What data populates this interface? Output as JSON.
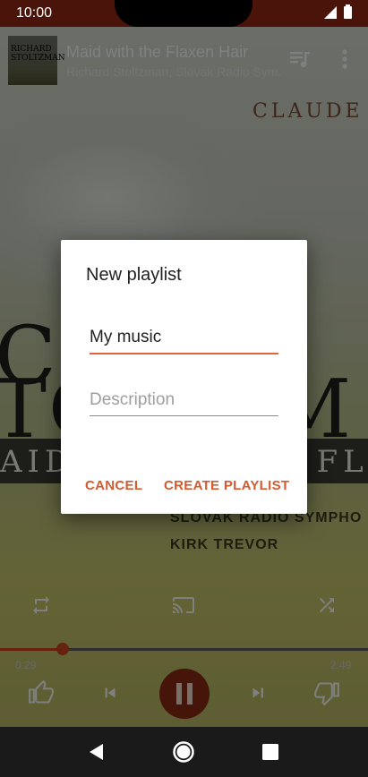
{
  "status_bar": {
    "time": "10:00"
  },
  "now_playing": {
    "title": "Maid with the Flaxen Hair",
    "artist": "Richard Stoltzman, Slovak Radio Sym...",
    "thumb_text_1": "RICHARD",
    "thumb_text_2": "STOLTZMAN"
  },
  "album_art": {
    "claude": "CLAUDE",
    "line1": "CH",
    "line2": "TO",
    "line2r": "M",
    "band_text": "AID WITH THE FLAXEN",
    "orchestra": "SLOVAK RADIO SYMPHO",
    "conductor": "KIRK TREVOR"
  },
  "dialog": {
    "title": "New playlist",
    "name_value": "My music",
    "description_placeholder": "Description",
    "cancel_label": "CANCEL",
    "create_label": "CREATE PLAYLIST"
  },
  "player": {
    "current_time": "0:29",
    "total_time": "2:49",
    "progress_fraction": 0.171
  },
  "colors": {
    "accent": "#d55a2f",
    "status_bar": "#4a140a"
  },
  "icons": [
    "signal-icon",
    "battery-icon",
    "queue-icon",
    "more-vert-icon",
    "repeat-icon",
    "cast-icon",
    "shuffle-icon",
    "thumb-up-icon",
    "skip-previous-icon",
    "pause-icon",
    "skip-next-icon",
    "thumb-down-icon",
    "back-icon",
    "home-icon",
    "recents-icon"
  ]
}
